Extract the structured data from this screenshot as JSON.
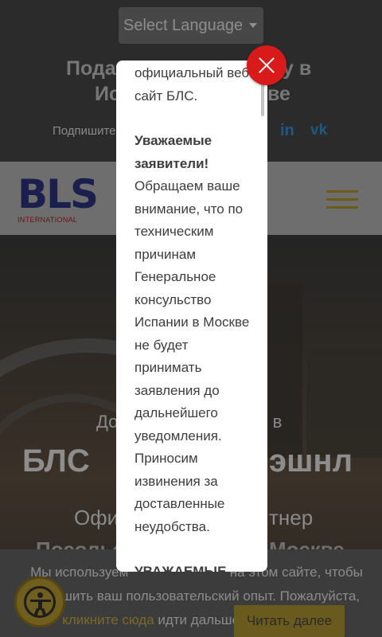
{
  "top": {
    "language_select": "Select Language",
    "title_line1": "Пода",
    "title_line1_right": "у в",
    "title_line2_left": "Ис",
    "title_line2_right": "ве",
    "subscribe_text": "Подпишите",
    "social_icons": [
      "linkedin-icon",
      "vk-icon"
    ],
    "linkedin_label": "in",
    "vk_label": "vk"
  },
  "header": {
    "logo_text": "BLS",
    "logo_sub": "INTERNATIONAL"
  },
  "hero": {
    "line1_left": "До",
    "line1_right": "ь в",
    "line2_left": "БЛС",
    "line2_right": "эшнл",
    "line3_left": "Офи",
    "line3_right": "тнер",
    "line4_left": "Посольс",
    "line4_right": "Москве"
  },
  "modal": {
    "text_top": "официальный веб-сайт БЛС.",
    "heading": "Уважаемые заявители!",
    "body": "Обращаем ваше внимание, что по техническим причинам Генеральное консульство Испании в Москве не будет принимать заявления до дальнейшего уведомления. Приносим извинения за доставленные неудобства.",
    "heading2": "УВАЖАЕМЫЕ"
  },
  "cookie": {
    "text_line1": "Мы используем",
    "text_line1_tail": "на этом сайте, чтобы",
    "text_line2": "улучшить ваш пользовательский опыт. Пожалуйста,",
    "link_text": "кликните сюда",
    "text_after_link": "идти дальше.",
    "button_label": "Читать далее"
  },
  "colors": {
    "accent": "#6b5a1e",
    "close": "#d91a1a",
    "logo_blue": "#1a1f4e"
  }
}
